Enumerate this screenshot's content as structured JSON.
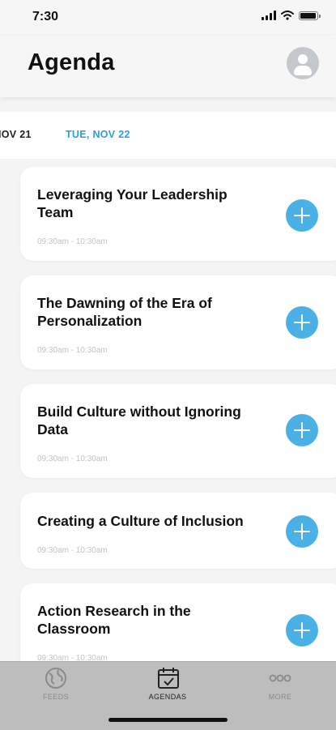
{
  "status_bar": {
    "time": "7:30"
  },
  "header": {
    "title": "Agenda"
  },
  "dates": {
    "previous": "IOV 21",
    "active": "TUE, NOV 22"
  },
  "sessions": [
    {
      "title": "Leveraging Your Leadership Team",
      "time": "09:30am - 10:30am"
    },
    {
      "title": "The Dawning of the Era of Personalization",
      "time": "09:30am - 10:30am"
    },
    {
      "title": "Build Culture without Ignoring Data",
      "time": "09:30am - 10:30am"
    },
    {
      "title": "Creating a Culture of Inclusion",
      "time": "09:30am - 10:30am"
    },
    {
      "title": "Action Research in the Classroom",
      "time": "09:30am - 10:30am"
    }
  ],
  "tab_bar": {
    "feeds": "FEEDS",
    "agendas": "AGENDAS",
    "more": "MORE"
  },
  "colors": {
    "accent": "#2aa0de",
    "add_button": "#4ab0e6",
    "tab_bar_bg": "#bdbdbd"
  },
  "icons": {
    "feeds": "globe-icon",
    "agendas": "calendar-check-icon",
    "more": "ellipsis-icon",
    "add": "plus-icon",
    "avatar": "user-icon"
  }
}
